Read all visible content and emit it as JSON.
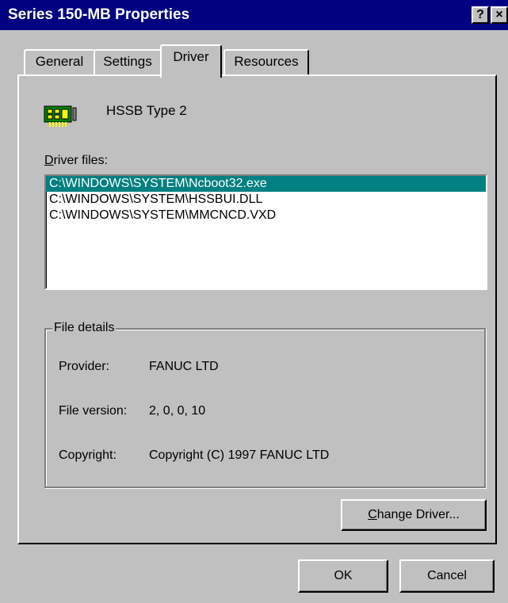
{
  "window": {
    "title": "Series 150-MB Properties",
    "help_glyph": "?",
    "close_glyph": "×"
  },
  "tabs": [
    {
      "label": "General"
    },
    {
      "label": "Settings"
    },
    {
      "label": "Driver",
      "active": true
    },
    {
      "label": "Resources"
    }
  ],
  "device": {
    "icon": "circuit-board-icon",
    "name": "HSSB Type 2"
  },
  "driver_files": {
    "label_first": "D",
    "label_rest": "river files:",
    "items": [
      {
        "path": "C:\\WINDOWS\\SYSTEM\\Ncboot32.exe",
        "selected": true
      },
      {
        "path": "C:\\WINDOWS\\SYSTEM\\HSSBUI.DLL",
        "selected": false
      },
      {
        "path": "C:\\WINDOWS\\SYSTEM\\MMCNCD.VXD",
        "selected": false
      }
    ]
  },
  "file_details": {
    "legend": "File details",
    "provider_label": "Provider:",
    "provider_value": "FANUC LTD",
    "version_label": "File version:",
    "version_value": "2, 0, 0, 10",
    "copyright_label": "Copyright:",
    "copyright_value": "Copyright (C) 1997 FANUC LTD"
  },
  "buttons": {
    "change_driver_first": "C",
    "change_driver_rest": "hange Driver...",
    "ok": "OK",
    "cancel": "Cancel"
  },
  "colors": {
    "titlebar": "#000080",
    "selection": "#008080",
    "face": "#c0c0c0"
  }
}
